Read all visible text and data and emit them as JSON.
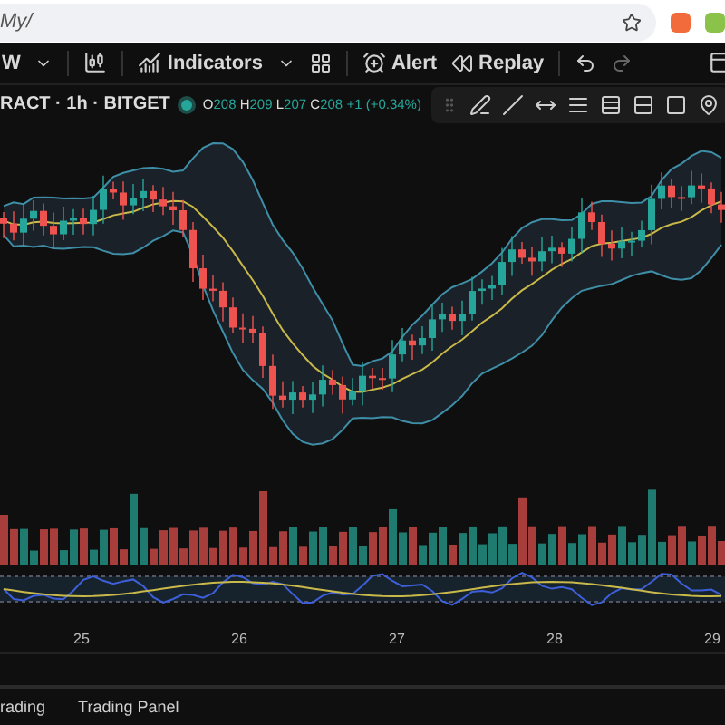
{
  "browser": {
    "url": "My/"
  },
  "toolbar": {
    "interval": "W",
    "indicators": "Indicators",
    "alert": "Alert",
    "replay": "Replay"
  },
  "legend": {
    "symbol": "RACT · 1h · BITGET",
    "live": true,
    "ohlc": [
      {
        "label": "O",
        "value": "208"
      },
      {
        "label": "H",
        "value": "209"
      },
      {
        "label": "L",
        "value": "207"
      },
      {
        "label": "C",
        "value": "208"
      }
    ],
    "change": "+1 (+0.34%)"
  },
  "time_axis": [
    "25",
    "26",
    "27",
    "28",
    "29"
  ],
  "bottom_tabs": [
    {
      "label": "rading",
      "selected": false
    },
    {
      "label": "Trading Panel",
      "selected": false
    }
  ]
}
